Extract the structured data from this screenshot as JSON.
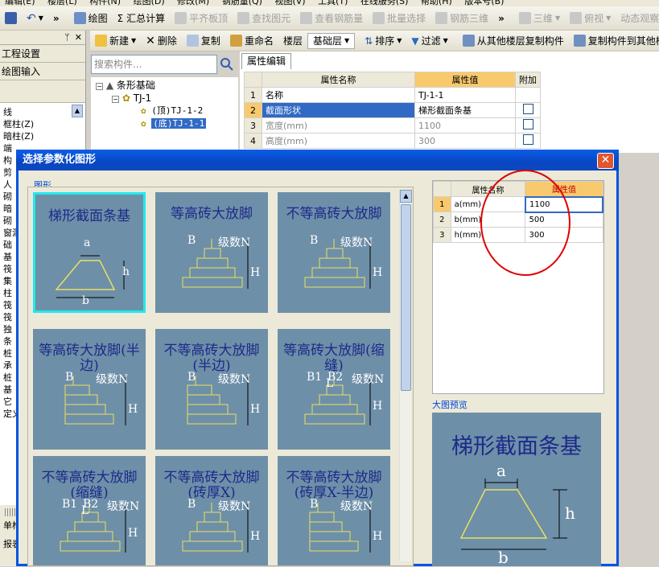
{
  "menubar": {
    "items": [
      "编辑(E)",
      "楼层(L)",
      "构件(N)",
      "绘图(D)",
      "修改(M)",
      "钢筋量(Q)",
      "视图(V)",
      "工具(T)",
      "在线服务(S)",
      "帮助(H)",
      "版本号(B)"
    ]
  },
  "toolbar1": {
    "draw": "绘图",
    "calc": "Σ 汇总计算",
    "align_top": "平齐板顶",
    "find": "查找图元",
    "view_rebar": "查看钢筋量",
    "batch_select": "批量选择",
    "rebar_3d": "钢筋三维",
    "view3d": "三维",
    "topview": "俯视",
    "dynamic": "动态观察"
  },
  "toolbar2": {
    "new": "新建",
    "delete": "删除",
    "copy": "复制",
    "rename": "重命名",
    "floor_label": "楼层",
    "floor_value": "基础层",
    "sort": "排序",
    "filter": "过滤",
    "copy_from_floor": "从其他楼层复制构件",
    "copy_to_floor": "复制构件到其他楼层"
  },
  "left_panel": {
    "sections": [
      "工程设置",
      "绘图输入"
    ],
    "items": [
      "线",
      "框柱(Z)",
      "暗柱(Z)",
      "端",
      "构",
      "剪",
      "人",
      "砌",
      "暗",
      "砌",
      "窗洞",
      "础",
      "基",
      "筏",
      "集",
      "柱",
      "筏",
      "筏",
      "独",
      "条",
      "桩",
      "承",
      "桩",
      "基",
      "它",
      "定义"
    ],
    "bottom": [
      "单构件",
      "报表"
    ]
  },
  "search": {
    "placeholder": "搜索构件..."
  },
  "tree": {
    "root": "条形基础",
    "child": "TJ-1",
    "leaf1": "(顶)TJ-1-2",
    "leaf2": "(底)TJ-1-1"
  },
  "prop": {
    "tab": "属性编辑",
    "col_name": "属性名称",
    "col_value": "属性值",
    "col_extra": "附加",
    "rows": [
      {
        "i": "1",
        "name": "名称",
        "value": "TJ-1-1"
      },
      {
        "i": "2",
        "name": "截面形状",
        "value": "梯形截面条基"
      },
      {
        "i": "3",
        "name": "宽度(mm)",
        "value": "1100"
      },
      {
        "i": "4",
        "name": "高度(mm)",
        "value": "300"
      }
    ]
  },
  "dialog": {
    "title": "选择参数化图形",
    "group_label": "图形",
    "preview_label": "大图预览",
    "tiles": [
      {
        "title": "梯形截面条基",
        "labels": [
          "a",
          "h",
          "b"
        ]
      },
      {
        "title": "等高砖大放脚",
        "labels": [
          "B",
          "级数N",
          "H"
        ]
      },
      {
        "title": "不等高砖大放脚",
        "labels": [
          "B",
          "级数N",
          "H"
        ]
      },
      {
        "title": "等高砖大放脚(半边)",
        "labels": [
          "B",
          "级数N",
          "H"
        ]
      },
      {
        "title": "不等高砖大放脚(半边)",
        "labels": [
          "B",
          "级数N",
          "H"
        ]
      },
      {
        "title": "等高砖大放脚(缩缝)",
        "labels": [
          "B1",
          "L",
          "B2",
          "级数N",
          "H"
        ]
      },
      {
        "title": "不等高砖大放脚(缩缝)",
        "labels": [
          "B1",
          "L",
          "B2",
          "级数N",
          "H"
        ]
      },
      {
        "title": "不等高砖大放脚(砖厚X)",
        "labels": [
          "B",
          "级数N",
          "H"
        ]
      },
      {
        "title": "不等高砖大放脚(砖厚X-半边)",
        "labels": [
          "B",
          "级数N",
          "H"
        ]
      }
    ],
    "params": {
      "col_name": "属性名称",
      "col_value": "属性值",
      "rows": [
        {
          "i": "1",
          "name": "a(mm)",
          "value": "1100"
        },
        {
          "i": "2",
          "name": "b(mm)",
          "value": "500"
        },
        {
          "i": "3",
          "name": "h(mm)",
          "value": "300"
        }
      ]
    },
    "preview": {
      "title": "梯形截面条基",
      "labels": [
        "a",
        "h",
        "b"
      ]
    }
  },
  "colors": {
    "title_bar": "#0a5fe6",
    "tile_bg": "#6e8fa8",
    "tile_text": "#1c2a8a",
    "line": "#e8e060",
    "highlight": "#20e8f0",
    "annotation": "#e00000"
  }
}
